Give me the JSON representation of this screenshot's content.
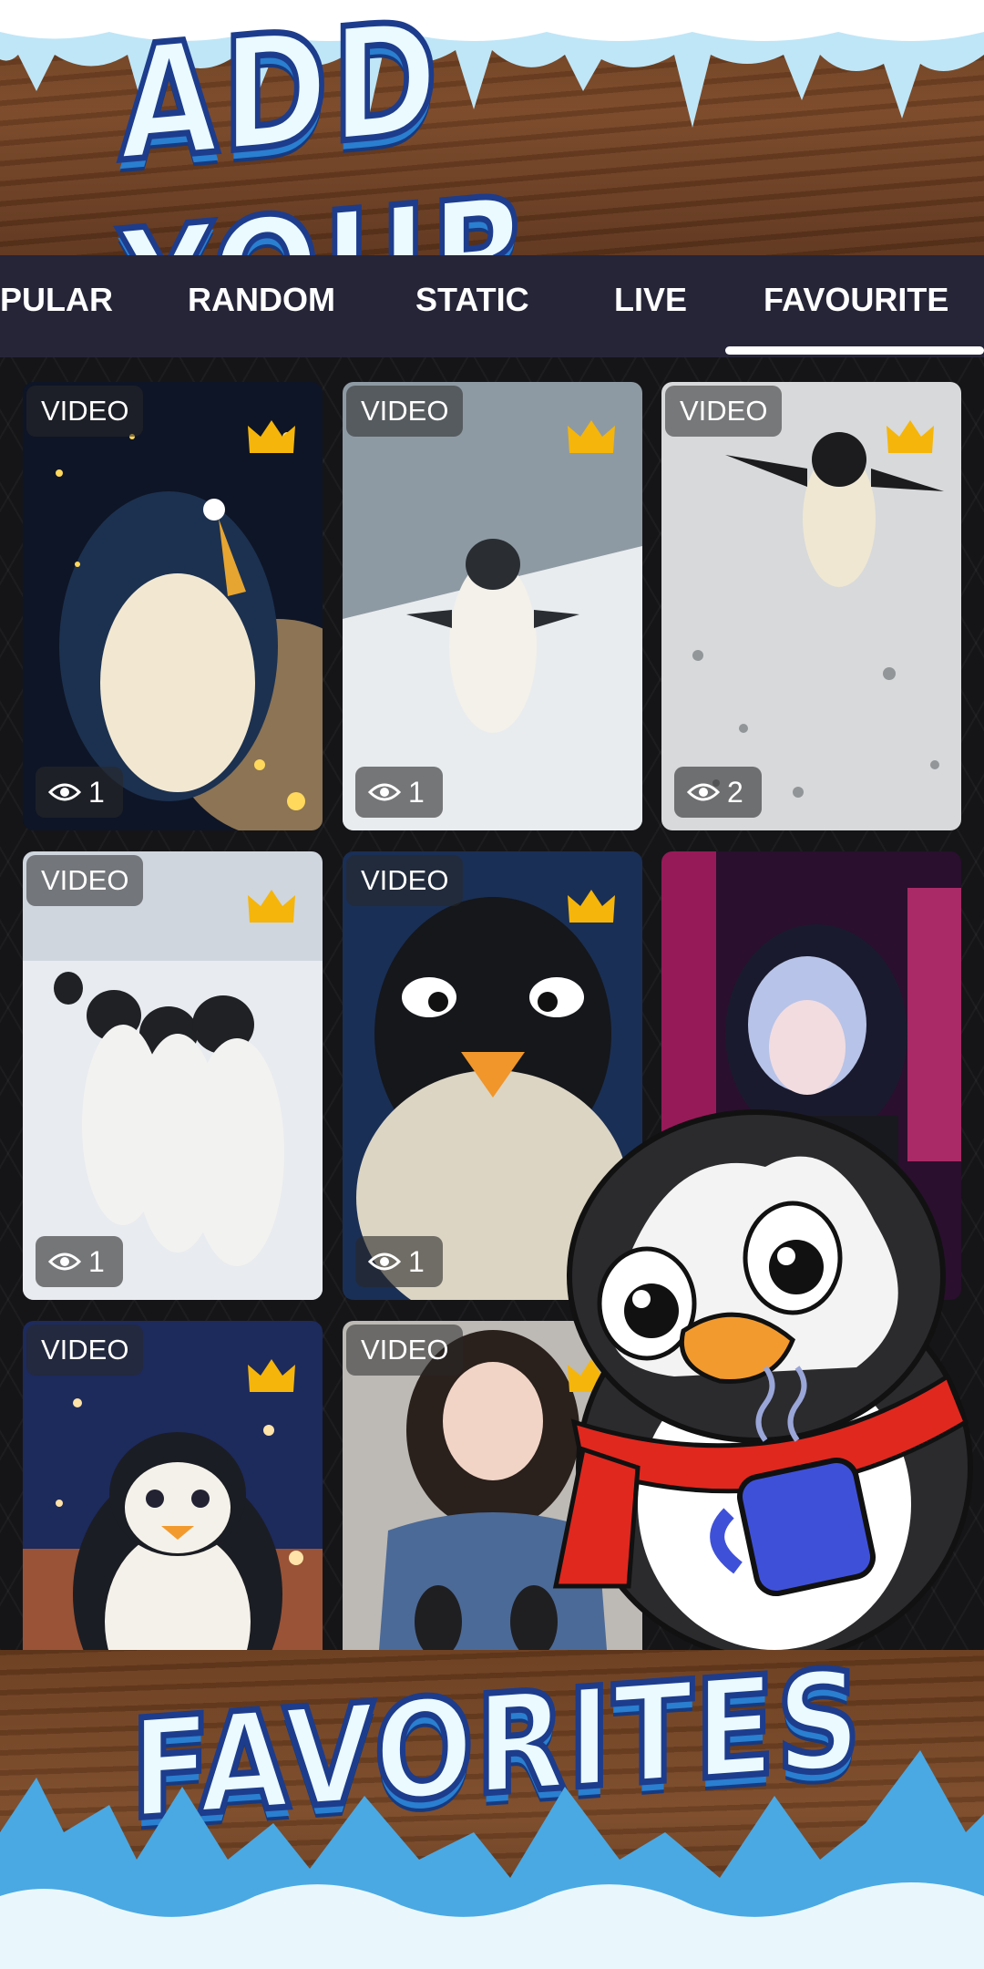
{
  "banner": {
    "headline_top": "ADD YOUR",
    "headline_bottom": "FAVORITES"
  },
  "tabs": [
    {
      "label": "PULAR"
    },
    {
      "label": "RANDOM"
    },
    {
      "label": "STATIC"
    },
    {
      "label": "LIVE"
    },
    {
      "label": "FAVOURITE",
      "selected": true
    }
  ],
  "wallpapers": [
    {
      "badge": "VIDEO",
      "premium": true,
      "views": "1"
    },
    {
      "badge": "VIDEO",
      "premium": true,
      "views": "1"
    },
    {
      "badge": "VIDEO",
      "premium": true,
      "views": "2"
    },
    {
      "badge": "VIDEO",
      "premium": true,
      "views": "1"
    },
    {
      "badge": "VIDEO",
      "premium": true,
      "views": "1"
    },
    {
      "badge": "",
      "premium": false,
      "views": ""
    },
    {
      "badge": "VIDEO",
      "premium": true,
      "views": ""
    },
    {
      "badge": "VIDEO",
      "premium": true,
      "views": ""
    }
  ],
  "colors": {
    "tab_bar": "#262538",
    "crown": "#f5b50a",
    "ice": "#5fc8f0",
    "wood": "#6b3e1f"
  },
  "icons": {
    "crown": "crown-icon",
    "eye": "eye-icon"
  }
}
